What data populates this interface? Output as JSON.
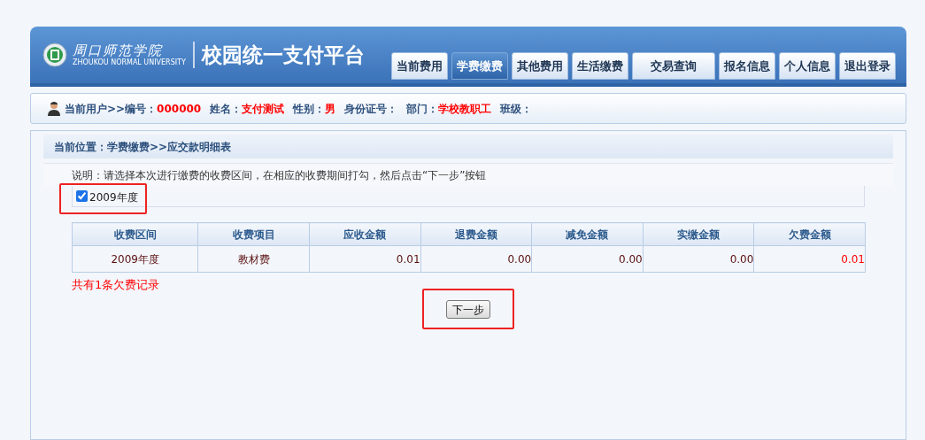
{
  "header": {
    "logo_name": "周口师范学院",
    "logo_subtitle": "ZHOUKOU NORMAL UNIVERSITY",
    "title": "校园统一支付平台"
  },
  "nav": [
    {
      "label": "当前费用",
      "selected": false
    },
    {
      "label": "学费缴费",
      "selected": true
    },
    {
      "label": "其他费用",
      "selected": false
    },
    {
      "label": "生活缴费",
      "selected": false
    },
    {
      "label": "交易查询",
      "selected": false
    },
    {
      "label": "报名信息",
      "selected": false
    },
    {
      "label": "个人信息",
      "selected": false
    },
    {
      "label": "退出登录",
      "selected": false
    }
  ],
  "user_bar": {
    "prefix": "当前用户>>",
    "fields": [
      {
        "label": "编号：",
        "value": "000000"
      },
      {
        "label": "姓名：",
        "value": "支付测试"
      },
      {
        "label": "性别：",
        "value": "男"
      },
      {
        "label": "身份证号："
      },
      {
        "label": "部门：",
        "value": "学校教职工"
      },
      {
        "label": "班级："
      }
    ]
  },
  "breadcrumb": "当前位置：学费缴费>>应交款明细表",
  "instruction": "说明：请选择本次进行缴费的收费区间，在相应的收费期间打勾，然后点击“下一步”按钮",
  "periods": [
    {
      "label": "2009年度",
      "checked": true,
      "highlighted": true
    }
  ],
  "table": {
    "columns": [
      "收费区间",
      "收费项目",
      "应收金额",
      "退费金额",
      "减免金额",
      "实缴金额",
      "欠费金额"
    ],
    "rows": [
      [
        "2009年度",
        "教材费",
        "0.01",
        "0.00",
        "0.00",
        "0.00",
        "0.01"
      ]
    ]
  },
  "summary": "共有1条欠费记录",
  "next_button": {
    "label": "下一步",
    "highlighted": true
  }
}
